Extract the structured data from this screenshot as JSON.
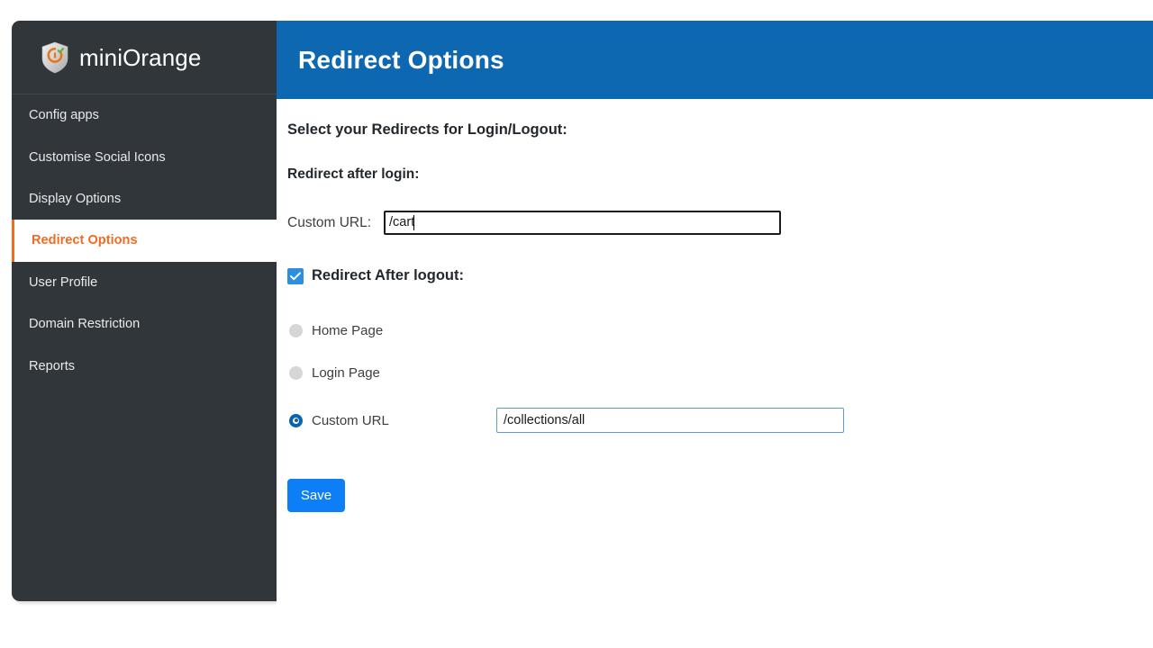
{
  "brand": {
    "name": "miniOrange",
    "logo_icon": "shield-check-icon"
  },
  "sidebar": {
    "items": [
      {
        "label": "Config apps",
        "active": false
      },
      {
        "label": "Customise Social Icons",
        "active": false
      },
      {
        "label": "Display Options",
        "active": false
      },
      {
        "label": "Redirect Options",
        "active": true
      },
      {
        "label": "User Profile",
        "active": false
      },
      {
        "label": "Domain Restriction",
        "active": false
      },
      {
        "label": "Reports",
        "active": false
      }
    ]
  },
  "header": {
    "title": "Redirect Options"
  },
  "main": {
    "section_title": "Select your Redirects for Login/Logout:",
    "login": {
      "sub_label": "Redirect after login:",
      "custom_url_label": "Custom URL:",
      "custom_url_value": "/cart"
    },
    "logout": {
      "checkbox_label": "Redirect After logout:",
      "checkbox_checked": true,
      "options": [
        {
          "label": "Home Page",
          "selected": false
        },
        {
          "label": "Login Page",
          "selected": false
        },
        {
          "label": "Custom URL",
          "selected": true
        }
      ],
      "custom_url_value": "/collections/all"
    },
    "save_label": "Save"
  },
  "colors": {
    "sidebar_bg": "#31363b",
    "header_blue": "#0d68b1",
    "accent_orange": "#f26b21",
    "checkbox_blue": "#2b8fe0",
    "radio_blue": "#0b63ae",
    "button_blue": "#0d7ef5",
    "input_focus_border": "#1a1a1a",
    "input_border_blue": "#5b9bd5"
  }
}
